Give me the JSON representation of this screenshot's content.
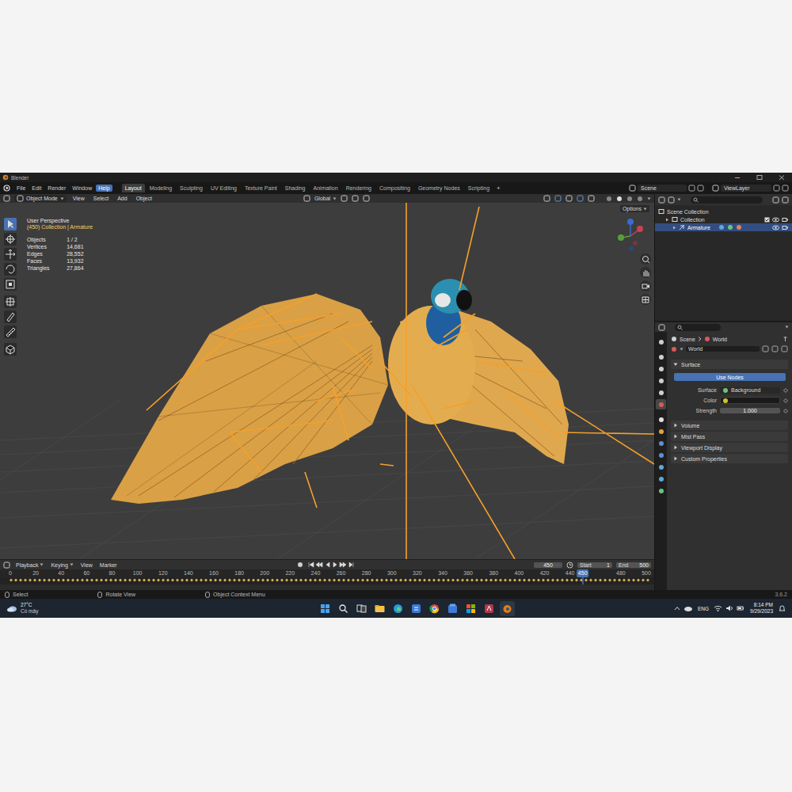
{
  "window": {
    "title": "Blender"
  },
  "menu": [
    {
      "label": "File",
      "selected": false
    },
    {
      "label": "Edit",
      "selected": false
    },
    {
      "label": "Render",
      "selected": false
    },
    {
      "label": "Window",
      "selected": false
    },
    {
      "label": "Help",
      "selected": true
    }
  ],
  "workspaces": [
    {
      "label": "Layout",
      "selected": true
    },
    {
      "label": "Modeling",
      "selected": false
    },
    {
      "label": "Sculpting",
      "selected": false
    },
    {
      "label": "UV Editing",
      "selected": false
    },
    {
      "label": "Texture Paint",
      "selected": false
    },
    {
      "label": "Shading",
      "selected": false
    },
    {
      "label": "Animation",
      "selected": false
    },
    {
      "label": "Rendering",
      "selected": false
    },
    {
      "label": "Compositing",
      "selected": false
    },
    {
      "label": "Geometry Nodes",
      "selected": false
    },
    {
      "label": "Scripting",
      "selected": false
    }
  ],
  "add_workspace": "+",
  "scene": "Scene",
  "view_layer": "ViewLayer",
  "viewport": {
    "mode": "Object Mode",
    "menus": [
      "View",
      "Select",
      "Add",
      "Object"
    ],
    "orientation": "Global",
    "options": "Options",
    "title": "User Perspective",
    "context": "(450) Collection | Armature",
    "stats": [
      {
        "label": "Objects",
        "value": "1 / 2"
      },
      {
        "label": "Vertices",
        "value": "14,681"
      },
      {
        "label": "Edges",
        "value": "28,552"
      },
      {
        "label": "Faces",
        "value": "13,932"
      },
      {
        "label": "Triangles",
        "value": "27,864"
      }
    ],
    "tools": [
      {
        "selected": true
      },
      {
        "selected": false
      },
      {
        "selected": false
      },
      {
        "selected": false
      },
      {
        "selected": false
      },
      {
        "selected": false
      },
      {
        "selected": false
      },
      {
        "selected": false
      },
      {
        "selected": false
      }
    ]
  },
  "outliner": {
    "items": [
      {
        "label": "Scene Collection",
        "depth": 0,
        "selected": false
      },
      {
        "label": "Collection",
        "depth": 1,
        "selected": false
      },
      {
        "label": "Armature",
        "depth": 2,
        "selected": true
      }
    ]
  },
  "properties": {
    "tabs": [
      {
        "selected": false
      },
      {
        "selected": false
      },
      {
        "selected": false
      },
      {
        "selected": false
      },
      {
        "selected": false
      },
      {
        "selected": true
      },
      {
        "selected": false
      },
      {
        "selected": false
      },
      {
        "selected": false
      },
      {
        "selected": false
      },
      {
        "selected": false
      },
      {
        "selected": false
      },
      {
        "selected": false
      }
    ],
    "breadcrumb": [
      "Scene",
      "World"
    ],
    "datablock": "World",
    "surface_panel": {
      "label": "Surface",
      "expanded": true
    },
    "use_nodes": "Use Nodes",
    "fields": [
      {
        "label": "Surface",
        "value": "Background",
        "kind": "link"
      },
      {
        "label": "Color",
        "kind": "color"
      },
      {
        "label": "Strength",
        "value": "1.000",
        "kind": "number"
      }
    ],
    "panels": [
      {
        "label": "Volume",
        "expanded": false
      },
      {
        "label": "Mist Pass",
        "expanded": false
      },
      {
        "label": "Viewport Display",
        "expanded": false
      },
      {
        "label": "Custom Properties",
        "expanded": false
      }
    ]
  },
  "timeline": {
    "menus": [
      "Playback",
      "Keying",
      "View",
      "Marker"
    ],
    "frame": "450",
    "start_label": "Start",
    "start": "1",
    "end_label": "End",
    "end": "500",
    "ticks": [
      "0",
      "20",
      "40",
      "60",
      "80",
      "100",
      "120",
      "140",
      "160",
      "180",
      "200",
      "220",
      "240",
      "260",
      "280",
      "300",
      "320",
      "340",
      "360",
      "380",
      "400",
      "420",
      "440",
      "480",
      "500"
    ],
    "playhead": "450"
  },
  "status_bar": {
    "hints": [
      "Select",
      "Rotate View",
      "Object Context Menu"
    ],
    "version": "3.6.2"
  },
  "taskbar": {
    "temperature": "27°C",
    "weather": "Có mây",
    "language": "ENG",
    "time": "8:14 PM",
    "date": "9/29/2023"
  }
}
